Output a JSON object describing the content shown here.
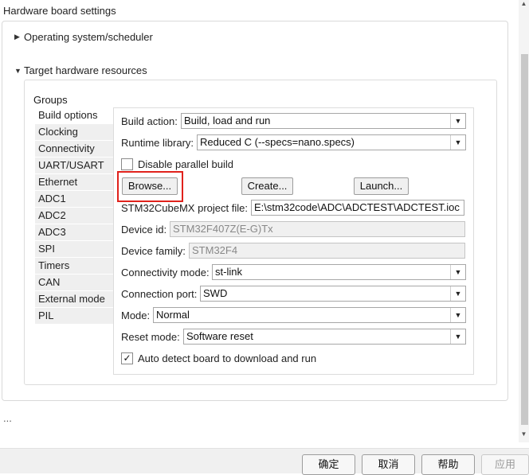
{
  "heading": "Hardware board settings",
  "sections": {
    "os": {
      "label": "Operating system/scheduler",
      "expanded": false
    },
    "target": {
      "label": "Target hardware resources",
      "expanded": true
    }
  },
  "groups": {
    "label": "Groups",
    "items": [
      "Build options",
      "Clocking",
      "Connectivity",
      "UART/USART",
      "Ethernet",
      "ADC1",
      "ADC2",
      "ADC3",
      "SPI",
      "Timers",
      "CAN",
      "External mode",
      "PIL"
    ],
    "selected": "Build options"
  },
  "build": {
    "build_action_label": "Build action:",
    "build_action_value": "Build, load and run",
    "runtime_label": "Runtime library:",
    "runtime_value": "Reduced C (--specs=nano.specs)",
    "disable_parallel_label": "Disable parallel build",
    "browse_label": "Browse...",
    "create_label": "Create...",
    "launch_label": "Launch...",
    "cubemx_label": "STM32CubeMX project file:",
    "cubemx_value": "E:\\stm32code\\ADC\\ADCTEST\\ADCTEST.ioc",
    "device_id_label": "Device id:",
    "device_id_value": "STM32F407Z(E-G)Tx",
    "device_family_label": "Device family:",
    "device_family_value": "STM32F4",
    "conn_mode_label": "Connectivity mode:",
    "conn_mode_value": "st-link",
    "conn_port_label": "Connection port:",
    "conn_port_value": "SWD",
    "mode_label": "Mode:",
    "mode_value": "Normal",
    "reset_label": "Reset mode:",
    "reset_value": "Software reset",
    "auto_detect_label": "Auto detect board to download and run",
    "auto_detect_checked": true,
    "disable_parallel_checked": false
  },
  "ellipsis": "...",
  "footer": {
    "ok": "确定",
    "cancel": "取消",
    "help": "帮助",
    "apply": "应用"
  },
  "colors": {
    "highlight": "#e0221c"
  },
  "icons": {
    "collapsed": "triangle-right",
    "expanded": "triangle-down",
    "dropdown": "chevron-down",
    "check": "check-mark"
  }
}
